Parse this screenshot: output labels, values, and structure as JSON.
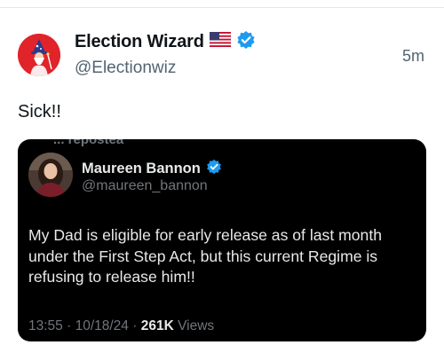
{
  "author": {
    "display_name": "Election Wizard",
    "handle": "@Electionwiz",
    "timestamp": "5m",
    "avatar_icon": "wizard-avatar-icon",
    "flag_icon": "us-flag-icon",
    "verified_icon": "verified-badge-icon"
  },
  "post": {
    "text": "Sick!!"
  },
  "quoted": {
    "reposted_line": "... repostea",
    "display_name": "Maureen Bannon",
    "handle": "@maureen_bannon",
    "verified_icon": "verified-badge-icon",
    "text": "My Dad is eligible for early release as of last month under the First Step Act, but this current Regime is refusing to release him!!",
    "time": "13:55",
    "date": "10/18/24",
    "views_count": "261K",
    "views_label": "Views"
  },
  "colors": {
    "avatar_bg": "#e0242a",
    "verified_blue": "#1d9bf0",
    "card_bg": "#000000",
    "secondary_text": "#536471"
  }
}
